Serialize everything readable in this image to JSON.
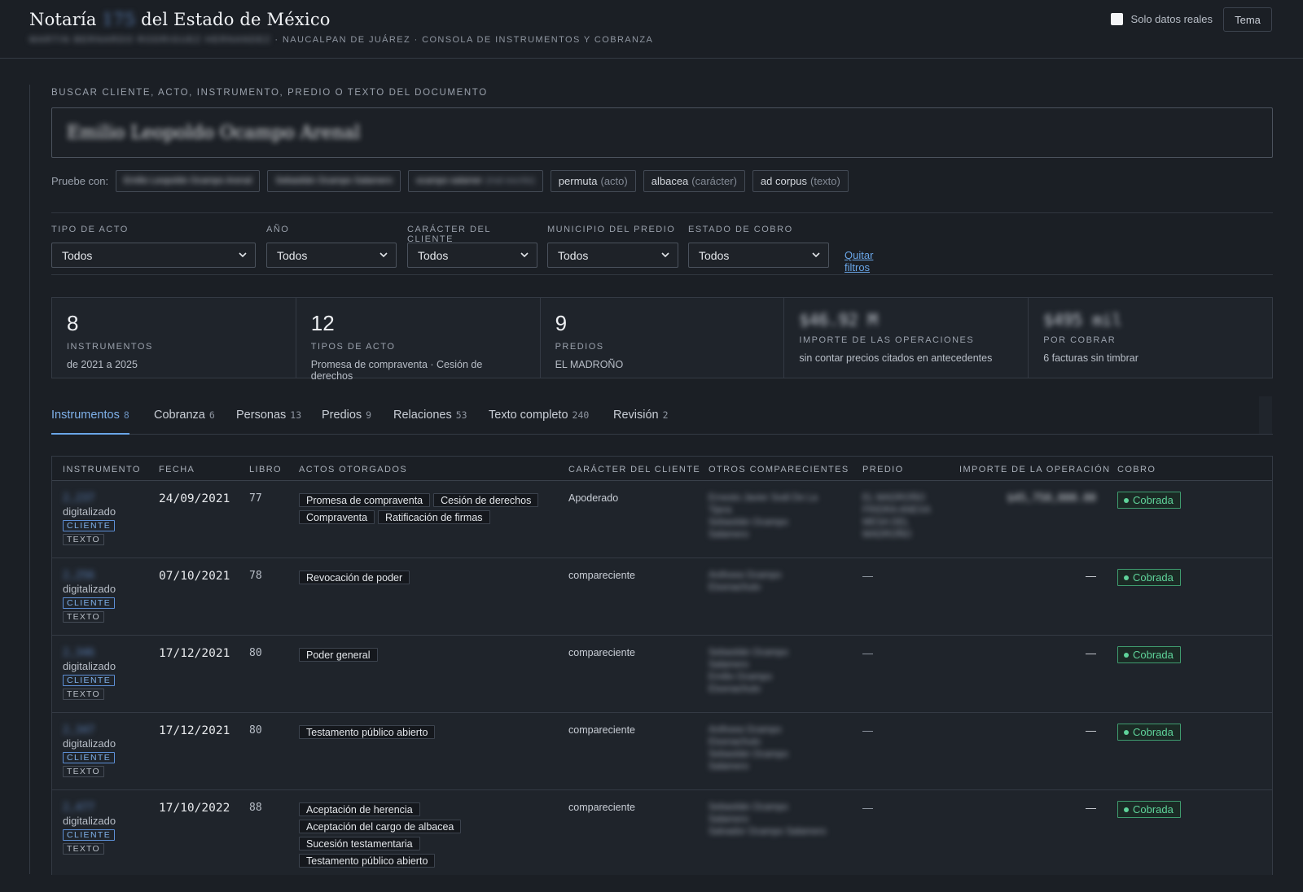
{
  "header": {
    "title_prefix": "Notaría",
    "title_number": "175",
    "title_suffix": "del Estado de México",
    "notary_name": "MARTIN BERNARDO RODRIGUEZ HERNANDEZ",
    "subtitle": "· NAUCALPAN DE JUÁREZ · CONSOLA DE INSTRUMENTOS Y COBRANZA",
    "real_data_label": "Solo datos reales",
    "theme_button": "Tema"
  },
  "search": {
    "label": "BUSCAR CLIENTE, ACTO, INSTRUMENTO, PREDIO O TEXTO DEL DOCUMENTO",
    "value": "Emilio Leopoldo Ocampo Arenal",
    "try_label": "Pruebe con:",
    "suggestions": [
      {
        "text": "Emilio Leopoldo Ocampo Arenal",
        "hint": "",
        "blurred": true
      },
      {
        "text": "Sebastián Ocampo Salamero",
        "hint": "",
        "blurred": true
      },
      {
        "text": "ocampo salamer",
        "hint": "(mal escrito)",
        "blurred": true
      },
      {
        "text": "permuta",
        "hint": "(acto)",
        "blurred": false
      },
      {
        "text": "albacea",
        "hint": "(carácter)",
        "blurred": false
      },
      {
        "text": "ad corpus",
        "hint": "(texto)",
        "blurred": false
      }
    ]
  },
  "filters": {
    "tipo_acto": {
      "label": "TIPO DE ACTO",
      "value": "Todos"
    },
    "anio": {
      "label": "AÑO",
      "value": "Todos"
    },
    "caracter": {
      "label": "CARÁCTER DEL CLIENTE",
      "value": "Todos"
    },
    "municipio": {
      "label": "MUNICIPIO DEL PREDIO",
      "value": "Todos"
    },
    "estado_cobro": {
      "label": "ESTADO DE COBRO",
      "value": "Todos"
    },
    "clear": "Quitar filtros"
  },
  "stats": [
    {
      "value": "8",
      "caption": "INSTRUMENTOS",
      "desc": "de 2021 a 2025",
      "blurred": false
    },
    {
      "value": "12",
      "caption": "TIPOS DE ACTO",
      "desc": "Promesa de compraventa · Cesión de derechos",
      "blurred": false
    },
    {
      "value": "9",
      "caption": "PREDIOS",
      "desc": "EL MADROÑO",
      "blurred": false
    },
    {
      "value": "$46.92 M",
      "caption": "IMPORTE DE LAS OPERACIONES",
      "desc": "sin contar precios citados en antecedentes",
      "blurred": true
    },
    {
      "value": "$495 mil",
      "caption": "POR COBRAR",
      "desc": "6 facturas sin timbrar",
      "blurred": true
    }
  ],
  "tabs": [
    {
      "label": "Instrumentos",
      "count": "8",
      "active": true
    },
    {
      "label": "Cobranza",
      "count": "6",
      "active": false
    },
    {
      "label": "Personas",
      "count": "13",
      "active": false
    },
    {
      "label": "Predios",
      "count": "9",
      "active": false
    },
    {
      "label": "Relaciones",
      "count": "53",
      "active": false
    },
    {
      "label": "Texto completo",
      "count": "240",
      "active": false
    },
    {
      "label": "Revisión",
      "count": "2",
      "active": false
    }
  ],
  "table": {
    "headers": [
      "INSTRUMENTO",
      "FECHA",
      "LIBRO",
      "ACTOS OTORGADOS",
      "CARÁCTER DEL CLIENTE",
      "OTROS COMPARECIENTES",
      "PREDIO",
      "IMPORTE DE LA OPERACIÓN",
      "COBRO"
    ],
    "badge_cliente": "CLIENTE",
    "badge_texto": "TEXTO",
    "rows": [
      {
        "instrumento": "2,237",
        "sub": "digitalizado",
        "fecha": "24/09/2021",
        "libro": "77",
        "actos": [
          "Promesa de compraventa",
          "Cesión de derechos",
          "Compraventa",
          "Ratificación de firmas"
        ],
        "caracter": "Apoderado",
        "otros": [
          "Ernesto Javier Sodi De La",
          "Tijera",
          "Sebastián Ocampo",
          "Salamero"
        ],
        "predio": [
          "EL MADROÑO",
          "FRIDRA ANEXA",
          "MESA DEL",
          "MADROÑO"
        ],
        "importe": "$45,750,000.00",
        "cobro": "Cobrada"
      },
      {
        "instrumento": "2,256",
        "sub": "digitalizado",
        "fecha": "07/10/2021",
        "libro": "78",
        "actos": [
          "Revocación de poder"
        ],
        "caracter": "compareciente",
        "otros": [
          "Anthoea Ocampo",
          "Etxenachuto"
        ],
        "predio": [
          "—"
        ],
        "importe": "—",
        "cobro": "Cobrada"
      },
      {
        "instrumento": "2,346",
        "sub": "digitalizado",
        "fecha": "17/12/2021",
        "libro": "80",
        "actos": [
          "Poder general"
        ],
        "caracter": "compareciente",
        "otros": [
          "Sebastián Ocampo",
          "Salamero",
          "Emilio Ocampo",
          "Etxenachuto"
        ],
        "predio": [
          "—"
        ],
        "importe": "—",
        "cobro": "Cobrada"
      },
      {
        "instrumento": "2,347",
        "sub": "digitalizado",
        "fecha": "17/12/2021",
        "libro": "80",
        "actos": [
          "Testamento público abierto"
        ],
        "caracter": "compareciente",
        "otros": [
          "Anthoea Ocampo",
          "Etxenachuto",
          "Sebastián Ocampo",
          "Salamero"
        ],
        "predio": [
          "—"
        ],
        "importe": "—",
        "cobro": "Cobrada"
      },
      {
        "instrumento": "2,477",
        "sub": "digitalizado",
        "fecha": "17/10/2022",
        "libro": "88",
        "actos": [
          "Aceptación de herencia",
          "Aceptación del cargo de albacea",
          "Sucesión testamentaria",
          "Testamento público abierto"
        ],
        "caracter": "compareciente",
        "otros": [
          "Sebastián Ocampo",
          "Salamero",
          "Salvador Ocampo Salamero"
        ],
        "predio": [
          "—"
        ],
        "importe": "—",
        "cobro": "Cobrada"
      }
    ]
  },
  "icons": {
    "select_chevron": "chevron-down-icon",
    "checkbox": "checkbox-icon",
    "status_dot": "dot-icon"
  },
  "colors": {
    "accent": "#6aa6e8",
    "success": "#5fd39a",
    "background": "#1b1f25"
  }
}
